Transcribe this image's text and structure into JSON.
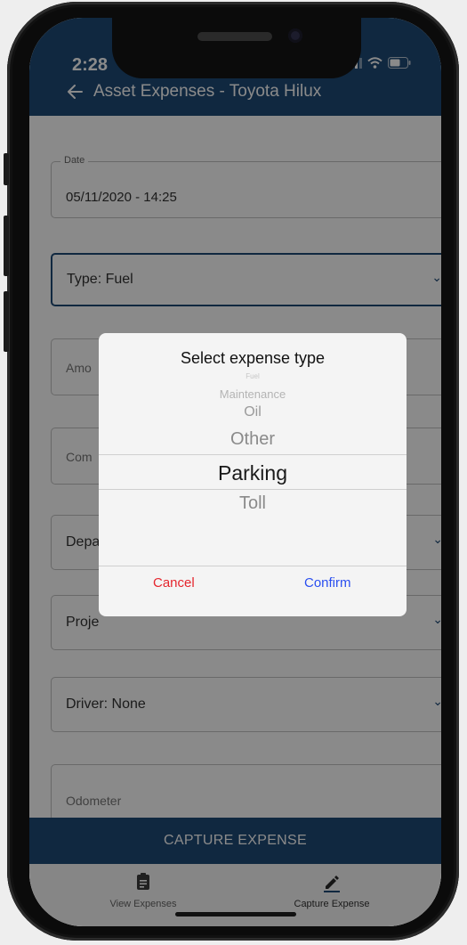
{
  "status_bar": {
    "time": "2:28"
  },
  "header": {
    "title": "Asset Expenses - Toyota Hilux"
  },
  "form": {
    "date": {
      "label": "Date",
      "value": "05/11/2020 - 14:25"
    },
    "type": {
      "value": "Type: Fuel"
    },
    "amount": {
      "placeholder": "Amo"
    },
    "comment": {
      "placeholder": "Com"
    },
    "department": {
      "value": "Depa"
    },
    "project": {
      "value": "Proje"
    },
    "driver": {
      "value": "Driver: None"
    },
    "odometer": {
      "placeholder": "Odometer"
    }
  },
  "dialog": {
    "title": "Select expense type",
    "options": [
      "Maintenance",
      "Oil",
      "Other",
      "Parking",
      "Toll"
    ],
    "selected": "Parking",
    "cancel_label": "Cancel",
    "confirm_label": "Confirm"
  },
  "capture_button": {
    "label": "CAPTURE EXPENSE"
  },
  "bottom_nav": {
    "view": {
      "label": "View Expenses",
      "icon": "clipboard-icon"
    },
    "capture": {
      "label": "Capture Expense",
      "icon": "pencil-icon"
    }
  },
  "colors": {
    "primary": "#1f4a76",
    "cancel": "#e5262e",
    "confirm": "#2b4ff0"
  }
}
